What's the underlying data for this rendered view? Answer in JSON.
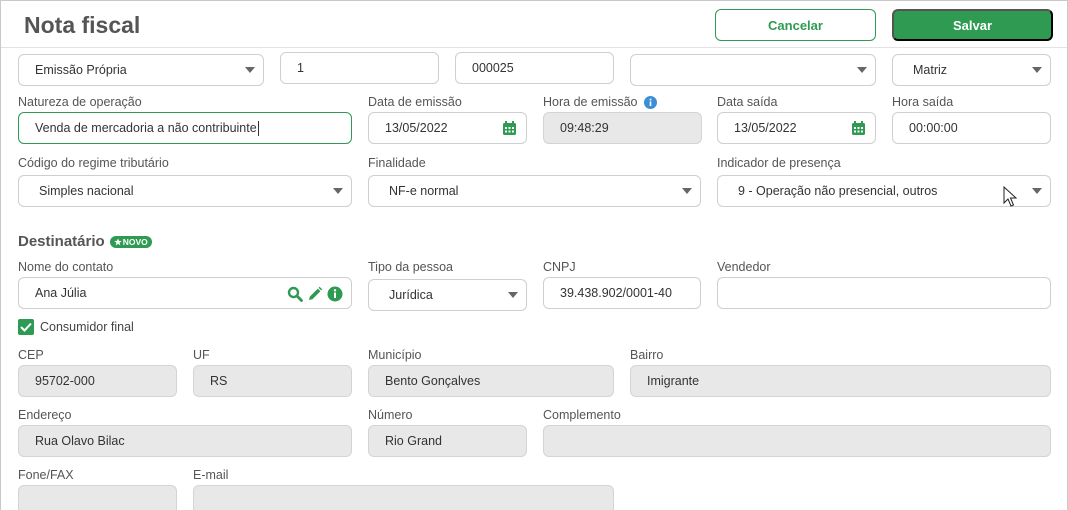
{
  "header": {
    "title": "Nota fiscal",
    "cancel_label": "Cancelar",
    "save_label": "Salvar"
  },
  "top_row": {
    "emissao": "Emissão Própria",
    "serie": "1",
    "numero": "000025",
    "modelo": "",
    "estabelecimento": "Matriz"
  },
  "row1": {
    "natureza_label": "Natureza de operação",
    "natureza_value": "Venda de mercadoria a não contribuinte",
    "data_emissao_label": "Data de emissão",
    "data_emissao_value": "13/05/2022",
    "hora_emissao_label": "Hora de emissão",
    "hora_emissao_value": "09:48:29",
    "data_saida_label": "Data saída",
    "data_saida_value": "13/05/2022",
    "hora_saida_label": "Hora saída",
    "hora_saida_value": "00:00:00"
  },
  "row2": {
    "regime_label": "Código do regime tributário",
    "regime_value": "Simples nacional",
    "finalidade_label": "Finalidade",
    "finalidade_value": "NF-e normal",
    "presenca_label": "Indicador de presença",
    "presenca_value": "9 - Operação não presencial, outros"
  },
  "destinatario": {
    "title": "Destinatário",
    "badge": "NOVO",
    "nome_label": "Nome do contato",
    "nome_value": "Ana Júlia",
    "tipo_label": "Tipo da pessoa",
    "tipo_value": "Jurídica",
    "cnpj_label": "CNPJ",
    "cnpj_value": "39.438.902/0001-40",
    "vendedor_label": "Vendedor",
    "vendedor_value": "",
    "consumidor_label": "Consumidor final",
    "cep_label": "CEP",
    "cep_value": "95702-000",
    "uf_label": "UF",
    "uf_value": "RS",
    "municipio_label": "Município",
    "municipio_value": "Bento Gonçalves",
    "bairro_label": "Bairro",
    "bairro_value": "Imigrante",
    "endereco_label": "Endereço",
    "endereco_value": "Rua Olavo Bilac",
    "numero_label": "Número",
    "numero_value": "Rio Grand",
    "complemento_label": "Complemento",
    "complemento_value": "",
    "fone_label": "Fone/FAX",
    "fone_value": "",
    "email_label": "E-mail",
    "email_value": ""
  },
  "colors": {
    "accent": "#2e9a52",
    "readonly": "#e8e8e8",
    "info": "#3b8fd6"
  },
  "icons": [
    "calendar-icon",
    "info-icon",
    "search-icon",
    "edit-icon",
    "chevron-down-icon",
    "check-icon",
    "star-icon",
    "mouse-cursor-icon"
  ]
}
